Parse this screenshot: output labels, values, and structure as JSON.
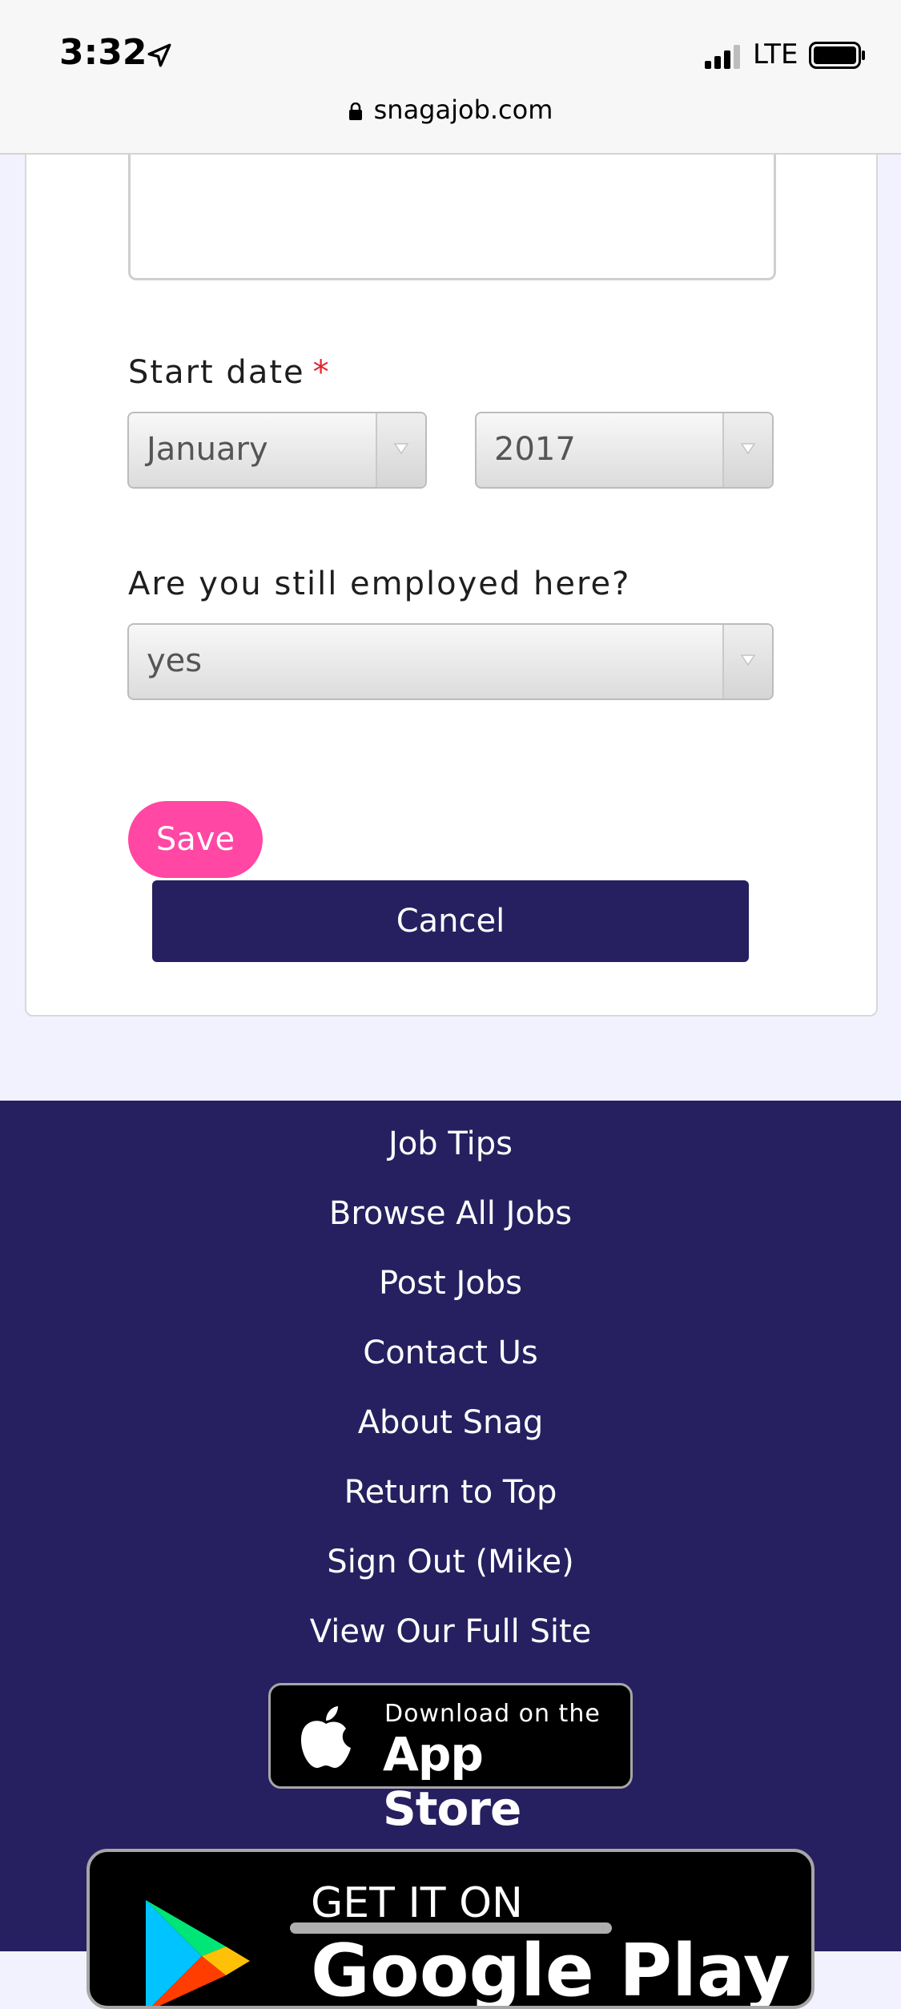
{
  "status_bar": {
    "time": "3:32",
    "network": "LTE"
  },
  "browser": {
    "url": "snagajob.com"
  },
  "form": {
    "start_date_label": "Start date",
    "required_marker": "*",
    "month_select_value": "January",
    "year_select_value": "2017",
    "still_employed_label": "Are you still employed here?",
    "still_employed_value": "yes",
    "save_label": "Save",
    "cancel_label": "Cancel"
  },
  "footer": {
    "links": [
      "Job Tips",
      "Browse All Jobs",
      "Post Jobs",
      "Contact Us",
      "About Snag",
      "Return to Top",
      "Sign Out (Mike)",
      "View Our Full Site"
    ],
    "app_store": {
      "small_text": "Download on the",
      "big_text": "App Store"
    },
    "google_play": {
      "small_text": "GET IT ON",
      "big_text": "Google Play"
    }
  },
  "colors": {
    "brand_navy": "#262060",
    "save_pink": "#ff47a3",
    "required_red": "#e3242b",
    "page_bg": "#f1f2fe"
  }
}
